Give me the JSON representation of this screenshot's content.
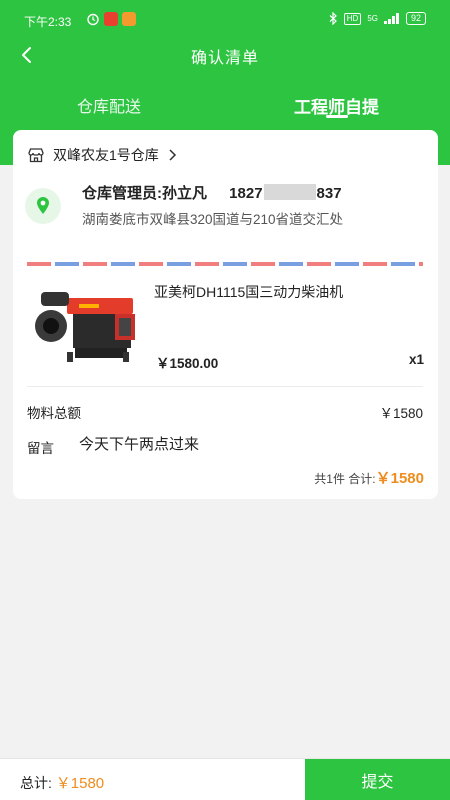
{
  "status_bar": {
    "time": "下午2:33",
    "network": "5G",
    "battery": "92"
  },
  "nav": {
    "title": "确认清单"
  },
  "tabs": [
    {
      "label": "仓库配送",
      "active": false
    },
    {
      "label": "工程师自提",
      "active": true
    }
  ],
  "warehouse": {
    "name": "双峰农友1号仓库"
  },
  "manager": {
    "label": "仓库管理员:孙立凡",
    "phone": "1827",
    "phone_tail": "837",
    "address": "湖南娄底市双峰县320国道与210省道交汇处"
  },
  "product": {
    "name": "亚美柯DH1115国三动力柴油机",
    "price": "￥1580.00",
    "qty": "x1"
  },
  "summary": {
    "material_total_label": "物料总额",
    "material_total_value": "￥1580",
    "message_label": "留言",
    "message_value": "今天下午两点过来",
    "count_text": "共1件 合计:",
    "grand_total": "￥1580"
  },
  "bottom": {
    "total_label": "总计:",
    "total_value": "￥1580",
    "submit_label": "提交"
  },
  "colors": {
    "brand": "#2dc441",
    "accent": "#f08c1e",
    "stripe_red": "#f07e7e",
    "stripe_blue": "#7a9fe0"
  }
}
